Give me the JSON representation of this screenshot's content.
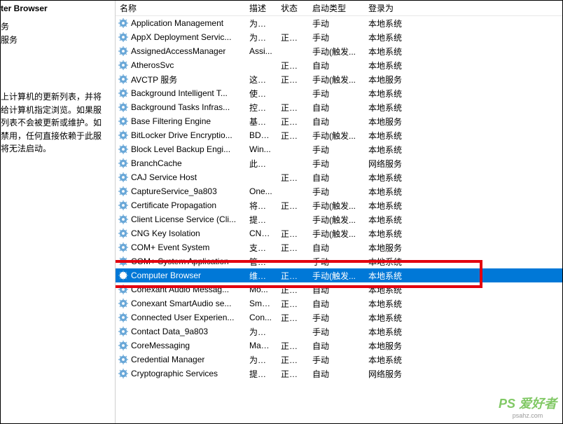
{
  "leftPanel": {
    "titleFragment": "ter Browser",
    "link1": "务",
    "link2": "服务",
    "descPrefix": "上计算机的更新列表，并将给计算机指定浏览。如果服列表不会被更新或维护。如禁用，任何直接依赖于此服将无法启动。"
  },
  "columns": {
    "name": "名称",
    "desc": "描述",
    "status": "状态",
    "startup": "启动类型",
    "logon": "登录为"
  },
  "services": [
    {
      "name": "Application Management",
      "desc": "为通...",
      "status": "",
      "startup": "手动",
      "logon": "本地系统"
    },
    {
      "name": "AppX Deployment Servic...",
      "desc": "为部...",
      "status": "正在...",
      "startup": "手动",
      "logon": "本地系统"
    },
    {
      "name": "AssignedAccessManager",
      "desc": "Assi...",
      "status": "",
      "startup": "手动(触发...",
      "logon": "本地系统"
    },
    {
      "name": "AtherosSvc",
      "desc": "",
      "status": "正在...",
      "startup": "自动",
      "logon": "本地系统"
    },
    {
      "name": "AVCTP 服务",
      "desc": "这是...",
      "status": "正在...",
      "startup": "手动(触发...",
      "logon": "本地服务"
    },
    {
      "name": "Background Intelligent T...",
      "desc": "使用...",
      "status": "",
      "startup": "手动",
      "logon": "本地系统"
    },
    {
      "name": "Background Tasks Infras...",
      "desc": "控制...",
      "status": "正在...",
      "startup": "自动",
      "logon": "本地系统"
    },
    {
      "name": "Base Filtering Engine",
      "desc": "基本...",
      "status": "正在...",
      "startup": "自动",
      "logon": "本地服务"
    },
    {
      "name": "BitLocker Drive Encryptio...",
      "desc": "BDE...",
      "status": "正在...",
      "startup": "手动(触发...",
      "logon": "本地系统"
    },
    {
      "name": "Block Level Backup Engi...",
      "desc": "Win...",
      "status": "",
      "startup": "手动",
      "logon": "本地系统"
    },
    {
      "name": "BranchCache",
      "desc": "此服...",
      "status": "",
      "startup": "手动",
      "logon": "网络服务"
    },
    {
      "name": "CAJ Service Host",
      "desc": "",
      "status": "正在...",
      "startup": "自动",
      "logon": "本地系统"
    },
    {
      "name": "CaptureService_9a803",
      "desc": "One...",
      "status": "",
      "startup": "手动",
      "logon": "本地系统"
    },
    {
      "name": "Certificate Propagation",
      "desc": "将用...",
      "status": "正在...",
      "startup": "手动(触发...",
      "logon": "本地系统"
    },
    {
      "name": "Client License Service (Cli...",
      "desc": "提供...",
      "status": "",
      "startup": "手动(触发...",
      "logon": "本地系统"
    },
    {
      "name": "CNG Key Isolation",
      "desc": "CNG...",
      "status": "正在...",
      "startup": "手动(触发...",
      "logon": "本地系统"
    },
    {
      "name": "COM+ Event System",
      "desc": "支持...",
      "status": "正在...",
      "startup": "自动",
      "logon": "本地服务"
    },
    {
      "name": "COM+ System Application",
      "desc": "管理...",
      "status": "",
      "startup": "手动",
      "logon": "本地系统"
    },
    {
      "name": "Computer Browser",
      "desc": "维护...",
      "status": "正在...",
      "startup": "手动(触发...",
      "logon": "本地系统",
      "selected": true
    },
    {
      "name": "Conexant Audio Messag...",
      "desc": "Mo...",
      "status": "正在...",
      "startup": "自动",
      "logon": "本地系统"
    },
    {
      "name": "Conexant SmartAudio se...",
      "desc": "Sma...",
      "status": "正在...",
      "startup": "自动",
      "logon": "本地系统"
    },
    {
      "name": "Connected User Experien...",
      "desc": "Con...",
      "status": "正在...",
      "startup": "手动",
      "logon": "本地系统"
    },
    {
      "name": "Contact Data_9a803",
      "desc": "为联...",
      "status": "",
      "startup": "手动",
      "logon": "本地系统"
    },
    {
      "name": "CoreMessaging",
      "desc": "Man...",
      "status": "正在...",
      "startup": "自动",
      "logon": "本地服务"
    },
    {
      "name": "Credential Manager",
      "desc": "为用...",
      "status": "正在...",
      "startup": "手动",
      "logon": "本地系统"
    },
    {
      "name": "Cryptographic Services",
      "desc": "提供...",
      "status": "正在...",
      "startup": "自动",
      "logon": "网络服务"
    }
  ],
  "watermark": {
    "brand": "PS 爱好者",
    "url": "psahz.com"
  }
}
